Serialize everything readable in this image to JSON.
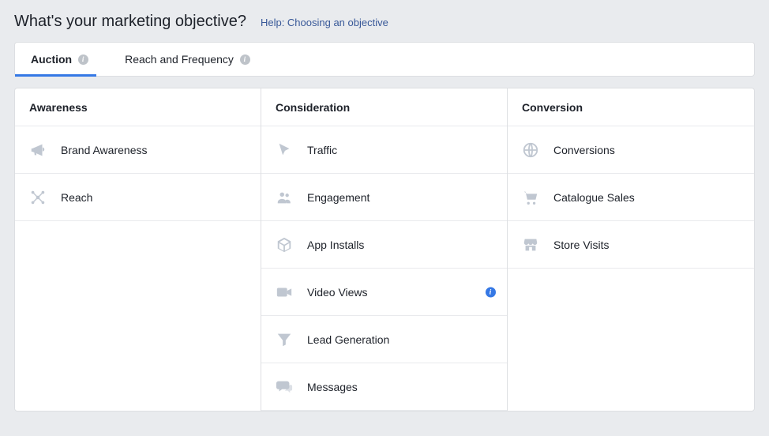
{
  "title": "What's your marketing objective?",
  "help_link": "Help: Choosing an objective",
  "tabs": {
    "auction": "Auction",
    "reach_freq": "Reach and Frequency"
  },
  "columns": {
    "awareness": {
      "header": "Awareness",
      "items": {
        "brand_awareness": "Brand Awareness",
        "reach": "Reach"
      }
    },
    "consideration": {
      "header": "Consideration",
      "items": {
        "traffic": "Traffic",
        "engagement": "Engagement",
        "app_installs": "App Installs",
        "video_views": "Video Views",
        "lead_generation": "Lead Generation",
        "messages": "Messages"
      }
    },
    "conversion": {
      "header": "Conversion",
      "items": {
        "conversions": "Conversions",
        "catalogue_sales": "Catalogue Sales",
        "store_visits": "Store Visits"
      }
    }
  }
}
